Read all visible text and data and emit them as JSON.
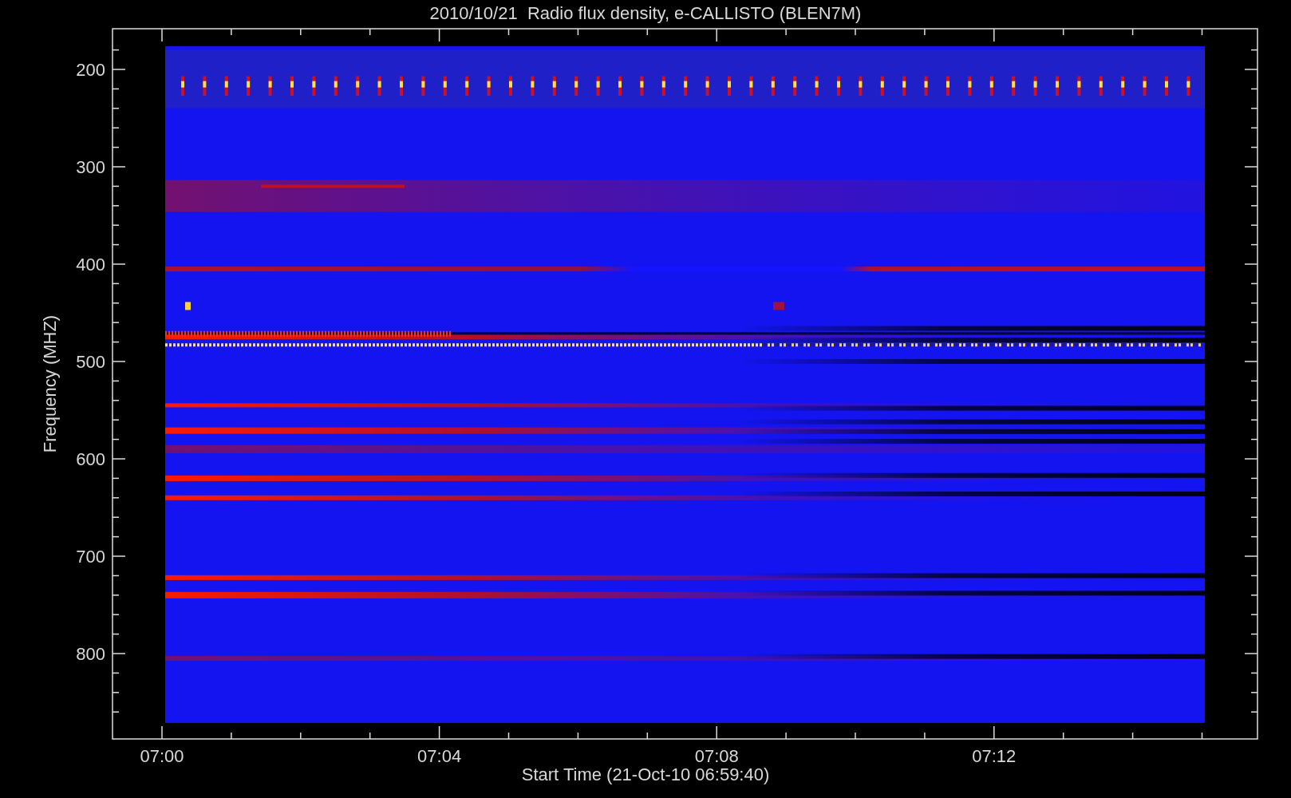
{
  "title": "2010/10/21  Radio flux density, e-CALLISTO (BLEN7M)",
  "xlabel": "Start Time (21-Oct-10 06:59:40)",
  "ylabel": "Frequency (MHZ)",
  "xticks": [
    "07:00",
    "07:04",
    "07:08",
    "07:12"
  ],
  "yticks": [
    "200",
    "300",
    "400",
    "500",
    "600",
    "700",
    "800"
  ]
}
